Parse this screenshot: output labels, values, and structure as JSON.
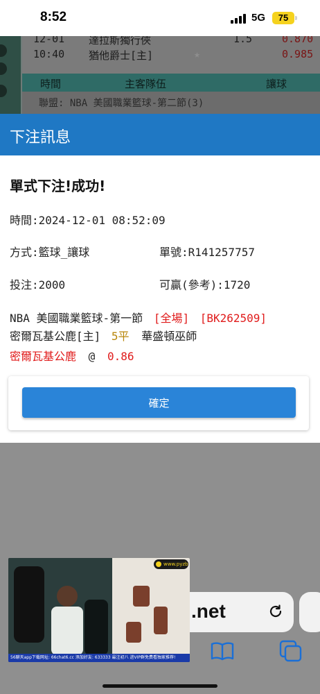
{
  "status_bar": {
    "time": "8:52",
    "network": "5G",
    "battery": "75"
  },
  "background": {
    "rows": [
      {
        "time": "12-01",
        "team": "達拉斯獨行俠",
        "handicap": "1.5",
        "odds": "0.870"
      },
      {
        "time": "10:40",
        "team": "猶他爵士[主]",
        "handicap": "",
        "odds": "0.985"
      }
    ],
    "header": {
      "time": "時間",
      "teams": "主客隊伍",
      "handicap": "讓球"
    },
    "league": "聯盟: NBA 美國職業籃球-第二節(3)"
  },
  "modal": {
    "title": "下注訊息",
    "success": "單式下注!成功!",
    "time_line": "時間:2024-12-01 08:52:09",
    "method": "方式:籃球_讓球",
    "order_no": "單號:R141257757",
    "stake": "投注:2000",
    "win": "可贏(參考):1720",
    "league": "NBA 美國職業籃球-第一節",
    "period_tag": "[全場]",
    "bet_code": "[BK262509]",
    "home_team": "密爾瓦基公鹿[主]",
    "spread": "5平",
    "away_team": "華盛頓巫師",
    "pick_team": "密爾瓦基公鹿",
    "at_sign": "@",
    "pick_odds": "0.86",
    "confirm_label": "確定"
  },
  "pip": {
    "logo": "www.pyzb",
    "ticker": "56聊天app下载网址: 66chat6.cc 添加好友: 633333 最注初八 进VIP群免费看独家推荐!"
  },
  "safari": {
    "url_suffix": ".net"
  },
  "colors": {
    "header_blue": "#1f78c4",
    "button_blue": "#2a84d8",
    "highlight_red": "#e01b1b",
    "spread_gold": "#b8860b"
  }
}
